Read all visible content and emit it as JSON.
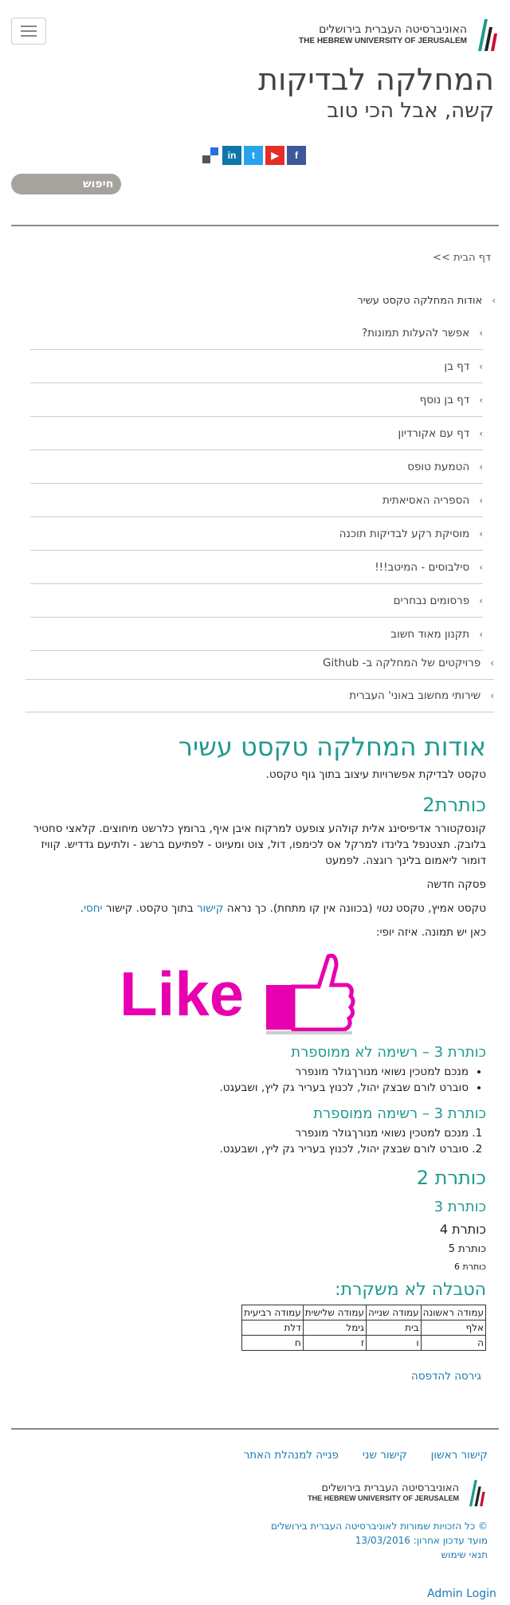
{
  "header": {
    "logo_he": "האוניברסיטה העברית בירושלים",
    "logo_en": "THE HEBREW UNIVERSITY OF JERUSALEM",
    "site_title": "המחלקה לבדיקות",
    "site_slogan": "קשה, אבל הכי טוב",
    "search_label": "חיפוש",
    "social": [
      {
        "name": "facebook",
        "glyph": "f",
        "color": "#3b5998"
      },
      {
        "name": "twitter",
        "glyph": "t",
        "color": "#2aa3ef"
      },
      {
        "name": "youtube",
        "glyph": "▶",
        "color": "#e52d27"
      },
      {
        "name": "linkedin",
        "glyph": "in",
        "color": "#0e76a8"
      }
    ]
  },
  "breadcrumb": "דף הבית >>",
  "menu": {
    "active": "אודות המחלקה טקסט עשיר",
    "children": [
      "אפשר להעלות תמונות?",
      "דף בן",
      "דף בן נוסף",
      "דף עם אקורדיון",
      "הטמעת טופס",
      "הספריה האסיאתית",
      "מוסיקת רקע לבדיקות תוכנה",
      "סילבוסים - המיטב!!!",
      "פרסומים נבחרים",
      "תקנון מאוד חשוב"
    ],
    "siblings": [
      "פרויקטים של המחלקה ב- Github",
      "שירותי מחשוב באוני' העברית"
    ]
  },
  "content": {
    "title": "אודות המחלקה טקסט עשיר",
    "intro": "טקסט לבדיקת אפשרויות עיצוב בתוך גוף טקסט.",
    "h2a": "כותרת2",
    "lorem": "קונסקטורר אדיפיסינג אלית קולהע צופעט למרקוח איבן איף, ברומץ כלרשט מיחוצים. קלאצי סחטיר בלובק. תצטנפל בלינדו למרקל אס לכימפו, דול, צוט ומעיוט - לפתיעם ברשג - ולתיעם גדדיש. קוויז דומור ליאמום בלינך רוגצה. לפמעט",
    "para_new": "פסקה חדשה",
    "p3_a": "טקסט אמיץ, טקסט ",
    "p3_b": "נטוי",
    "p3_c": " (בכוונה אין קו מתחת). כך נראה ",
    "p3_link1": "קישור",
    "p3_d": " בתוך טקסט. קישור ",
    "p3_link2": "יחסי",
    "p3_e": ".",
    "image_caption": "כאן יש תמונה. איזה יופי:",
    "like_text": "Like",
    "h3_ul": "כותרת 3 – רשימה לא ממוספרת",
    "ul": [
      "מנכם למטכין נשואי מנורךגולר מונפרר",
      "סוברט לורם שבצק יהול, לכנוץ בעריר גק ליץ, ושבעגט."
    ],
    "h3_ol": "כותרת 3 – רשימה ממוספרת",
    "ol": [
      "מנכם למטכין נשואי מנורךגולר מונפרר",
      "סוברט לורם שבצק יהול, לכנוץ בעריר גק ליץ, ושבעגט."
    ],
    "h2b": "כותרת 2",
    "h3": "כותרת 3",
    "h4": "כותרת 4",
    "h5": "כותרת 5",
    "h6": "כותרת 6",
    "table_title": "הטבלה לא משקרת:",
    "table_headers": [
      "עמודה ראשונה",
      "עמודה שנייה",
      "עמודה שלישית",
      "עמודה רביעית"
    ],
    "table_rows": [
      [
        "אלף",
        "בית",
        "גימל",
        "דלת"
      ],
      [
        "ה",
        "ו",
        "ז",
        "ח"
      ]
    ],
    "print": "גירסה להדפסה"
  },
  "footer": {
    "links": [
      "קישור ראשון",
      "קישור שני",
      "פנייה למנהלת האתר"
    ],
    "copyright": "© כל הזכויות שמורות לאוניברסיטה העברית בירושלים",
    "updated": "מועד עדכון אחרון: 13/03/2016",
    "terms": "תנאי שימוש",
    "admin": "Admin Login"
  },
  "colors": {
    "accent": "#1e9a8e",
    "link": "#1a7bb0",
    "like": "#e800b0"
  }
}
